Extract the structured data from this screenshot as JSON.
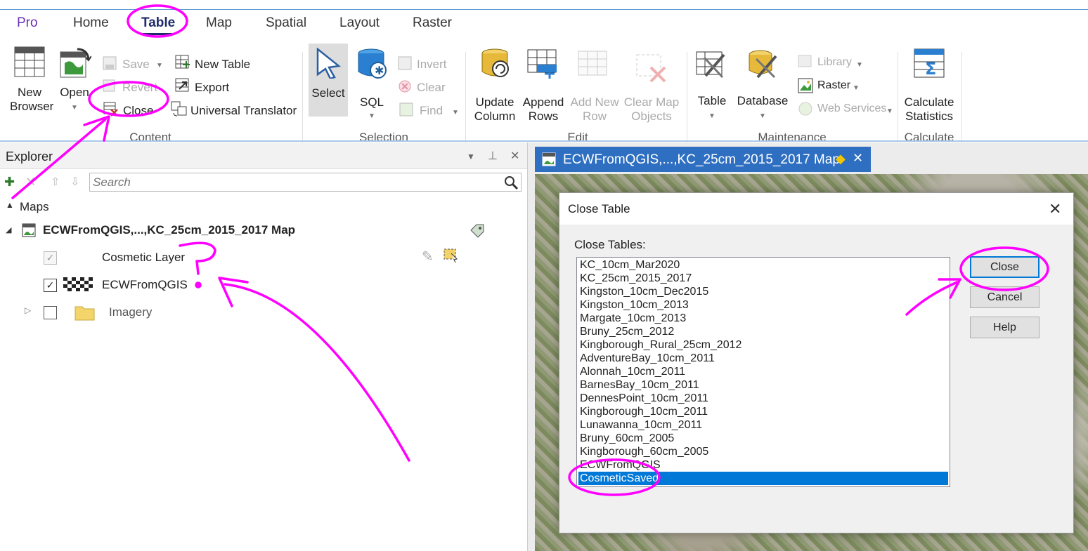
{
  "ribbon": {
    "tabs": [
      {
        "label": "Pro"
      },
      {
        "label": "Home"
      },
      {
        "label": "Table"
      },
      {
        "label": "Map"
      },
      {
        "label": "Spatial"
      },
      {
        "label": "Layout"
      },
      {
        "label": "Raster"
      }
    ],
    "active_tab": "Table",
    "content": {
      "new_browser": "New\nBrowser",
      "open": "Open",
      "save": "Save",
      "revert": "Revert",
      "close": "Close",
      "new_table": "New Table",
      "export": "Export",
      "universal_translator": "Universal Translator",
      "group": "Content"
    },
    "selection": {
      "select": "Select",
      "sql": "SQL",
      "invert": "Invert",
      "clear": "Clear",
      "find": "Find",
      "group": "Selection"
    },
    "edit": {
      "update_column": "Update\nColumn",
      "append_rows": "Append\nRows",
      "add_new_row": "Add New\nRow",
      "clear_map_objects": "Clear Map\nObjects",
      "group": "Edit"
    },
    "maintenance": {
      "table": "Table",
      "database": "Database",
      "library": "Library",
      "raster": "Raster",
      "web_services": "Web Services",
      "group": "Maintenance"
    },
    "calculate": {
      "calculate_statistics": "Calculate\nStatistics",
      "group": "Calculate"
    }
  },
  "explorer": {
    "title": "Explorer",
    "search_placeholder": "Search",
    "maps_label": "Maps",
    "map_name": "ECWFromQGIS,...,KC_25cm_2015_2017 Map",
    "layers": [
      {
        "label": "Cosmetic Layer",
        "checked": true
      },
      {
        "label": "ECWFromQGIS",
        "checked": true
      },
      {
        "label": "Imagery",
        "checked": false
      }
    ]
  },
  "map_tab": {
    "title": "ECWFromQGIS,...,KC_25cm_2015_2017 Map"
  },
  "dialog": {
    "title": "Close Table",
    "list_label": "Close Tables:",
    "tables": [
      "KC_10cm_Mar2020",
      "KC_25cm_2015_2017",
      "Kingston_10cm_Dec2015",
      "Kingston_10cm_2013",
      "Margate_10cm_2013",
      "Bruny_25cm_2012",
      "Kingborough_Rural_25cm_2012",
      "AdventureBay_10cm_2011",
      "Alonnah_10cm_2011",
      "BarnesBay_10cm_2011",
      "DennesPoint_10cm_2011",
      "Kingborough_10cm_2011",
      "Lunawanna_10cm_2011",
      "Bruny_60cm_2005",
      "Kingborough_60cm_2005",
      "ECWFromQGIS",
      "CosmeticSaved"
    ],
    "selected_table": "CosmeticSaved",
    "buttons": {
      "close": "Close",
      "cancel": "Cancel",
      "help": "Help"
    }
  },
  "colors": {
    "accent": "#2f6fc1",
    "selection": "#0078d7",
    "annotation": "#ff00ff",
    "pro_tab": "#6b2fb3"
  }
}
